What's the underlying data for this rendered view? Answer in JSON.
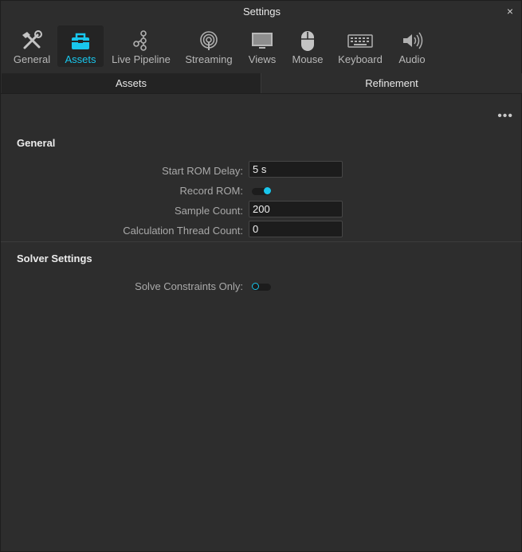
{
  "window": {
    "title": "Settings",
    "close_glyph": "×"
  },
  "toolbar": {
    "items": [
      {
        "label": "General",
        "icon": "tools-icon"
      },
      {
        "label": "Assets",
        "icon": "toolbox-icon",
        "active": true
      },
      {
        "label": "Live Pipeline",
        "icon": "pipeline-icon"
      },
      {
        "label": "Streaming",
        "icon": "broadcast-icon"
      },
      {
        "label": "Views",
        "icon": "monitor-icon"
      },
      {
        "label": "Mouse",
        "icon": "mouse-icon"
      },
      {
        "label": "Keyboard",
        "icon": "keyboard-icon"
      },
      {
        "label": "Audio",
        "icon": "speaker-icon"
      }
    ]
  },
  "tabs": [
    {
      "label": "Assets"
    },
    {
      "label": "Refinement",
      "selected": true
    }
  ],
  "more_glyph": "•••",
  "general": {
    "title": "General",
    "start_rom_delay": {
      "label": "Start ROM Delay:",
      "value": "5 s"
    },
    "record_rom": {
      "label": "Record ROM:",
      "on": true
    },
    "sample_count": {
      "label": "Sample Count:",
      "value": "200"
    },
    "calc_thread_count": {
      "label": "Calculation Thread Count:",
      "value": "0"
    }
  },
  "solver": {
    "title": "Solver Settings",
    "solve_constraints_only": {
      "label": "Solve Constraints Only:",
      "on": false
    }
  },
  "colors": {
    "accent": "#19c6ec",
    "background": "#2d2d2d",
    "field": "#1c1c1c"
  }
}
